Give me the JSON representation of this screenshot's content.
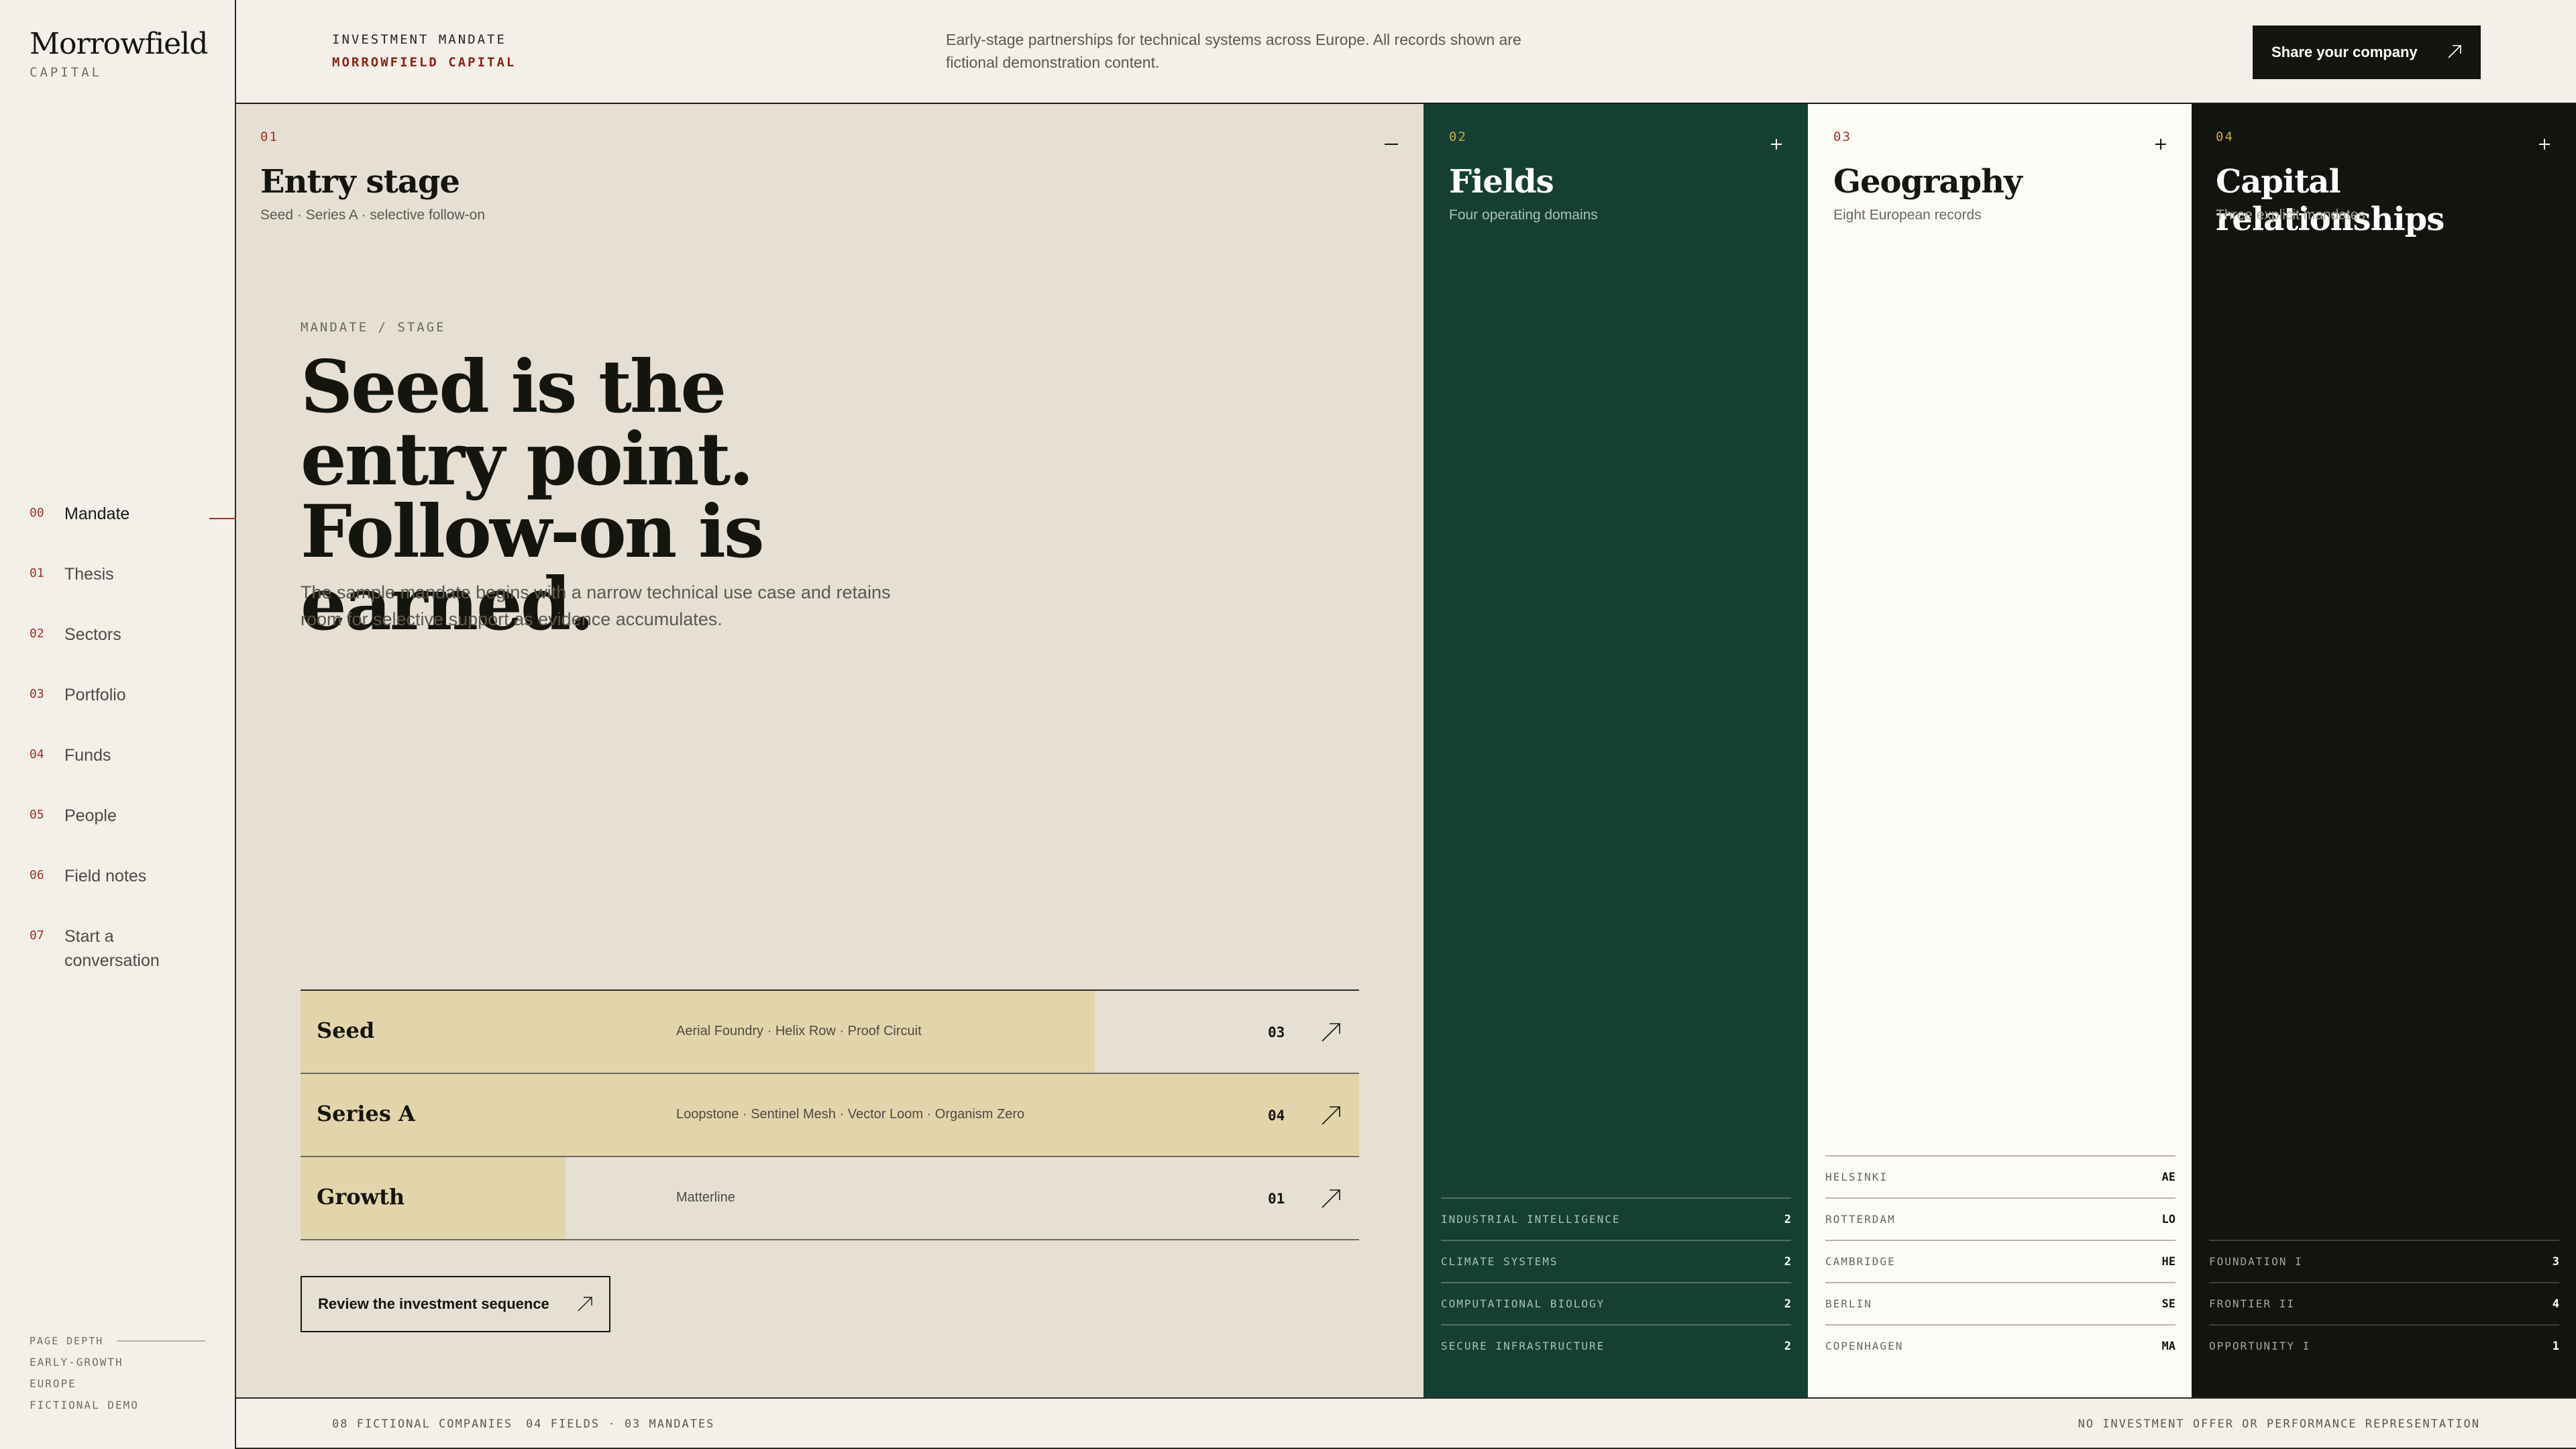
{
  "brand": {
    "name": "Morrowfield",
    "sub": "CAPITAL"
  },
  "nav": [
    {
      "num": "00",
      "label": "Mandate"
    },
    {
      "num": "01",
      "label": "Thesis"
    },
    {
      "num": "02",
      "label": "Sectors"
    },
    {
      "num": "03",
      "label": "Portfolio"
    },
    {
      "num": "04",
      "label": "Funds"
    },
    {
      "num": "05",
      "label": "People"
    },
    {
      "num": "06",
      "label": "Field notes"
    },
    {
      "num": "07",
      "label": "Start a conversation"
    }
  ],
  "depth": {
    "label": "PAGE DEPTH",
    "items": [
      "EARLY-GROWTH",
      "EUROPE",
      "FICTIONAL DEMO"
    ]
  },
  "header": {
    "kicker": "INVESTMENT MANDATE",
    "firm": "MORROWFIELD CAPITAL",
    "description": "Early-stage partnerships for technical systems across Europe. All records shown are fictional demonstration content.",
    "cta": "Share your company"
  },
  "panels": {
    "entry": {
      "num": "01",
      "title": "Entry stage",
      "sub": "Seed · Series A · selective follow-on",
      "kicker": "MANDATE / STAGE",
      "headline": "Seed is the entry point. Follow-on is earned.",
      "lead": "The sample mandate begins with a narrow technical use case and retains room for selective support as evidence accumulates.",
      "stages": [
        {
          "name": "Seed",
          "companies": "Aerial Foundry · Helix Row · Proof Circuit",
          "count": "03",
          "fill": 0.75
        },
        {
          "name": "Series A",
          "companies": "Loopstone · Sentinel Mesh · Vector Loom · Organism Zero",
          "count": "04",
          "fill": 1.0
        },
        {
          "name": "Growth",
          "companies": "Matterline",
          "count": "01",
          "fill": 0.25
        }
      ],
      "review": "Review the investment sequence"
    },
    "fields": {
      "num": "02",
      "title": "Fields",
      "sub": "Four operating domains",
      "items": [
        {
          "label": "INDUSTRIAL INTELLIGENCE",
          "value": "2"
        },
        {
          "label": "CLIMATE SYSTEMS",
          "value": "2"
        },
        {
          "label": "COMPUTATIONAL BIOLOGY",
          "value": "2"
        },
        {
          "label": "SECURE INFRASTRUCTURE",
          "value": "2"
        }
      ]
    },
    "geography": {
      "num": "03",
      "title": "Geography",
      "sub": "Eight European records",
      "items": [
        {
          "label": "HELSINKI",
          "value": "AE"
        },
        {
          "label": "ROTTERDAM",
          "value": "LO"
        },
        {
          "label": "CAMBRIDGE",
          "value": "HE"
        },
        {
          "label": "BERLIN",
          "value": "SE"
        },
        {
          "label": "COPENHAGEN",
          "value": "MA"
        }
      ]
    },
    "capital": {
      "num": "04",
      "title": "Capital relationships",
      "sub": "Three explicit mandates",
      "items": [
        {
          "label": "FOUNDATION I",
          "value": "3"
        },
        {
          "label": "FRONTIER II",
          "value": "4"
        },
        {
          "label": "OPPORTUNITY I",
          "value": "1"
        }
      ]
    }
  },
  "footer": {
    "companies": "08 FICTIONAL COMPANIES",
    "fields": "04 FIELDS · 03 MANDATES",
    "disclaimer": "NO INVESTMENT OFFER OR PERFORMANCE REPRESENTATION"
  },
  "colors": {
    "accent": "#9b3222",
    "fields_bg": "#163f33",
    "capital_bg": "#11140f",
    "stage_fill": "#e3d5ab",
    "gold": "#c9a94a"
  }
}
